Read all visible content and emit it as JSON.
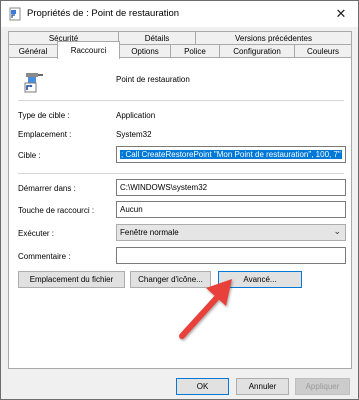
{
  "window": {
    "title": "Propriétés de : Point de restauration",
    "close_glyph": "✕"
  },
  "tabs": {
    "row1": [
      {
        "label": "Sécurité"
      },
      {
        "label": "Détails"
      },
      {
        "label": "Versions précédentes"
      }
    ],
    "row2": [
      {
        "label": "Général"
      },
      {
        "label": "Raccourci",
        "active": true
      },
      {
        "label": "Options"
      },
      {
        "label": "Police"
      },
      {
        "label": "Configuration"
      },
      {
        "label": "Couleurs"
      }
    ]
  },
  "shortcut": {
    "name": "Point de restauration",
    "icon": "shortcut-arrow-icon",
    "type_label": "Type de cible :",
    "type_value": "Application",
    "location_label": "Emplacement :",
    "location_value": "System32",
    "target_label": "Cible :",
    "target_value": "; Call CreateRestorePoint \"Mon Point de restauration\", 100, 7\"",
    "start_in_label": "Démarrer dans :",
    "start_in_value": "C:\\WINDOWS\\system32",
    "hotkey_label": "Touche de raccourci :",
    "hotkey_value": "Aucun",
    "run_label": "Exécuter :",
    "run_value": "Fenêtre normale",
    "comment_label": "Commentaire :",
    "comment_value": ""
  },
  "buttons": {
    "open_location": "Emplacement du fichier",
    "change_icon": "Changer d'icône...",
    "advanced": "Avancé...",
    "ok": "OK",
    "cancel": "Annuler",
    "apply": "Appliquer"
  },
  "colors": {
    "selection": "#0078d7",
    "annotation_arrow": "#e8413a"
  }
}
